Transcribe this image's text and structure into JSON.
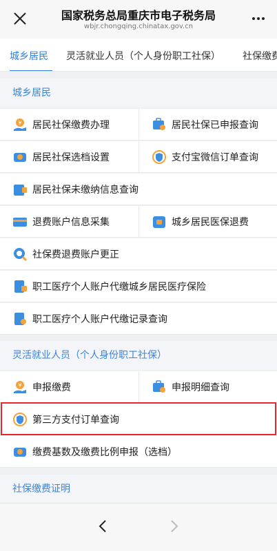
{
  "header": {
    "title": "国家税务总局重庆市电子税务局",
    "url": "wbjr.chongqing.chinatax.gov.cn"
  },
  "tabs": [
    {
      "label": "城乡居民"
    },
    {
      "label": "灵活就业人员（个人身份职工社保）"
    },
    {
      "label": "社保缴费"
    }
  ],
  "sections": [
    {
      "title": "城乡居民",
      "items": [
        {
          "label": "居民社保缴费办理",
          "icon": "hand-coin-icon"
        },
        {
          "label": "居民社保已申报查询",
          "icon": "briefcase-search-icon"
        },
        {
          "label": "居民社保选档设置",
          "icon": "wallet-icon"
        },
        {
          "label": "支付宝微信订单查询",
          "icon": "shield-pay-icon"
        },
        {
          "label": "居民社保未缴纳信息查询",
          "icon": "folder-coin-icon"
        },
        {
          "label": "退费账户信息采集",
          "icon": "card-icon"
        },
        {
          "label": "城乡居民医保退费",
          "icon": "refund-icon"
        },
        {
          "label": "社保费退费账户更正",
          "icon": "magnifier-icon"
        },
        {
          "label": "职工医疗个人账户代缴城乡居民医疗保险",
          "icon": "document-icon"
        },
        {
          "label": "职工医疗个人账户代缴记录查询",
          "icon": "document-search-icon"
        }
      ]
    },
    {
      "title": "灵活就业人员（个人身份职工社保）",
      "items": [
        {
          "label": "申报缴费",
          "icon": "hand-coin-icon"
        },
        {
          "label": "申报明细查询",
          "icon": "briefcase-search-icon"
        },
        {
          "label": "第三方支付订单查询",
          "icon": "shield-pay-icon"
        },
        {
          "label": "缴费基数及缴费比例申报（选档）",
          "icon": "wallet-icon"
        }
      ]
    },
    {
      "title": "社保缴费证明",
      "items": []
    }
  ],
  "colors": {
    "accent": "#2f80d8",
    "section_text": "#3c84d6",
    "highlight": "#e8262a",
    "icon_orange": "#f5a23a",
    "icon_blue": "#3b8ee0"
  }
}
